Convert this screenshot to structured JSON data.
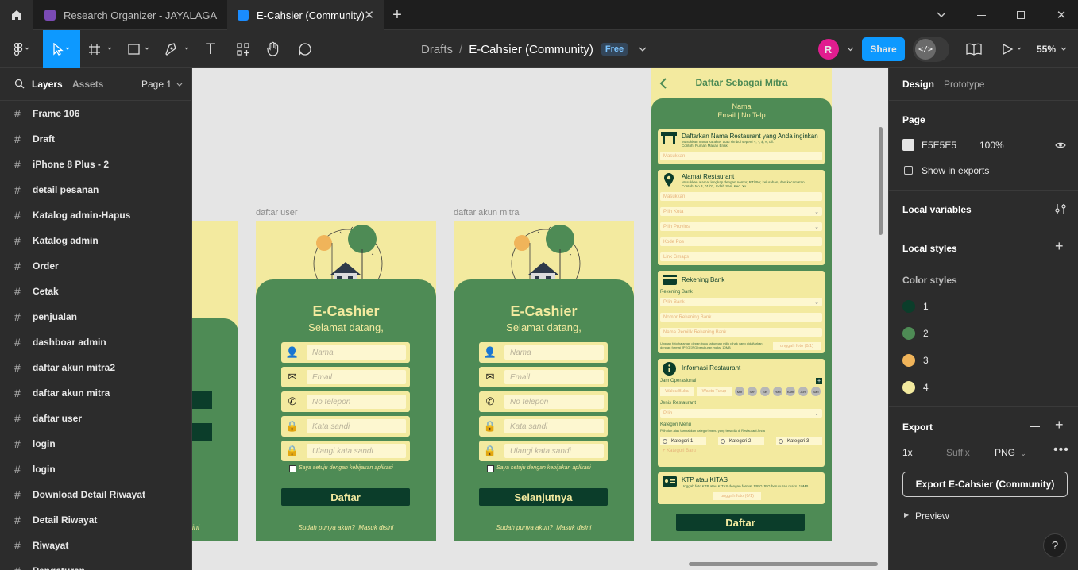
{
  "tabs": {
    "home_icon": "home-icon",
    "tab1": "Research Organizer - JAYALAGA",
    "tab2": "E-Cahsier (Community)",
    "add_icon": "plus-icon"
  },
  "toolbar": {
    "breadcrumb_parent": "Drafts",
    "separator": "/",
    "file_name": "E-Cahsier (Community)",
    "plan_badge": "Free",
    "avatar_letter": "R",
    "share_label": "Share",
    "zoom": "55%"
  },
  "left": {
    "tab_layers": "Layers",
    "tab_assets": "Assets",
    "page_selector": "Page 1",
    "layers": [
      "Frame 106",
      "Draft",
      "iPhone 8 Plus - 2",
      "detail pesanan",
      "Katalog admin-Hapus",
      "Katalog admin",
      "Order",
      "Cetak",
      "penjualan",
      "dashboar admin",
      "daftar akun mitra2",
      "daftar akun mitra",
      "daftar user",
      "login",
      "login",
      "Download Detail Riwayat",
      "Detail Riwayat",
      "Riwayat",
      "Pengaturan"
    ]
  },
  "canvas": {
    "frame_label_user": "daftar user",
    "frame_label_mitra": "daftar akun mitra",
    "app_title": "E-Cashier",
    "welcome": "Selamat datang,",
    "placeholders": [
      "Nama",
      "Email",
      "No telepon",
      "Kata sandi",
      "Ulangi kata sandi"
    ],
    "agree": "Saya setuju dengan kebijakan aplikasi",
    "btn_daftar": "Daftar",
    "btn_selanjutnya": "Selanjutnya",
    "have_account": "Sudah punya akun?",
    "login_link": "Masuk disini",
    "partial_left_text": "ini",
    "mitra": {
      "header": "Daftar Sebagai Mitra",
      "name": "Nama",
      "contact": "Email | No.Telp",
      "s1_title": "Daftarkan Nama Restaurant yang Anda inginkan",
      "s1_hint": "Masukkan nama karakter atau simbol seperti +, *, $, #, dll.",
      "s1_example": "Contoh: Rumah Makan Enak",
      "s1_input": "Masukkan",
      "s2_title": "Alamat Restaurant",
      "s2_hint": "Masukkan alamat lengkap dengan nomor, RT/RW, kelurahan, dan kecamatan",
      "s2_example": "Contoh: No.3, 01/01, Indah Sari, Kec. Xx",
      "s2_inputs": [
        "Masukkan",
        "Pilih Kota",
        "Pilih Provinsi",
        "Kode Pos",
        "Link Gmaps"
      ],
      "s3_title": "Rekening Bank",
      "s3_label": "Rekening Bank",
      "s3_inputs": [
        "Pilih Bank",
        "Nomor Rekening Bank",
        "Nama Pemilik Rekening Bank"
      ],
      "s3_note": "Unggah foto halaman depan buku tabungan milik pihak yang didaftarkan dengan format JPEG/JPG berukuran maks. 10MB",
      "s3_upload": "unggah foto (0/1)",
      "s4_title": "Informasi Restaurant",
      "s4_jam": "Jam Operasional",
      "s4_open": "Waktu Buka",
      "s4_close": "Waktu Tutup",
      "days": [
        "Min",
        "Sen",
        "Sel",
        "Rab",
        "Kam",
        "Jum",
        "Sab"
      ],
      "s4_jenis": "Jenis Restaurant",
      "s4_pilih": "Pilih",
      "s4_kategori": "Kategori Menu",
      "s4_kategori_hint": "Pilih dan atau tambahkan kategori menu yang tersedia di Restaurant Anda",
      "kategori": [
        "Kategori 1",
        "Kategori 2",
        "Kategori 3"
      ],
      "s4_add": "+ Kategori Baru",
      "s5_title": "KTP atau KITAS",
      "s5_hint": "Unggah foto KTP atau KITAS dengan format JPEG/JPG berukuran maks. 10MB",
      "s5_upload": "unggah foto (0/1)",
      "btn": "Daftar"
    }
  },
  "right": {
    "tab_design": "Design",
    "tab_prototype": "Prototype",
    "page_title": "Page",
    "page_color": "E5E5E5",
    "page_opacity": "100%",
    "show_exports": "Show in exports",
    "local_variables": "Local variables",
    "local_styles": "Local styles",
    "color_styles": "Color styles",
    "colors": [
      {
        "name": "1",
        "hex": "#0b3d2a"
      },
      {
        "name": "2",
        "hex": "#4e8b55"
      },
      {
        "name": "3",
        "hex": "#f0b45a"
      },
      {
        "name": "4",
        "hex": "#f3ea9f"
      }
    ],
    "export_title": "Export",
    "export_scale": "1x",
    "export_suffix": "Suffix",
    "export_format": "PNG",
    "export_button": "Export E-Cahsier (Community)",
    "preview": "Preview",
    "help": "?"
  }
}
